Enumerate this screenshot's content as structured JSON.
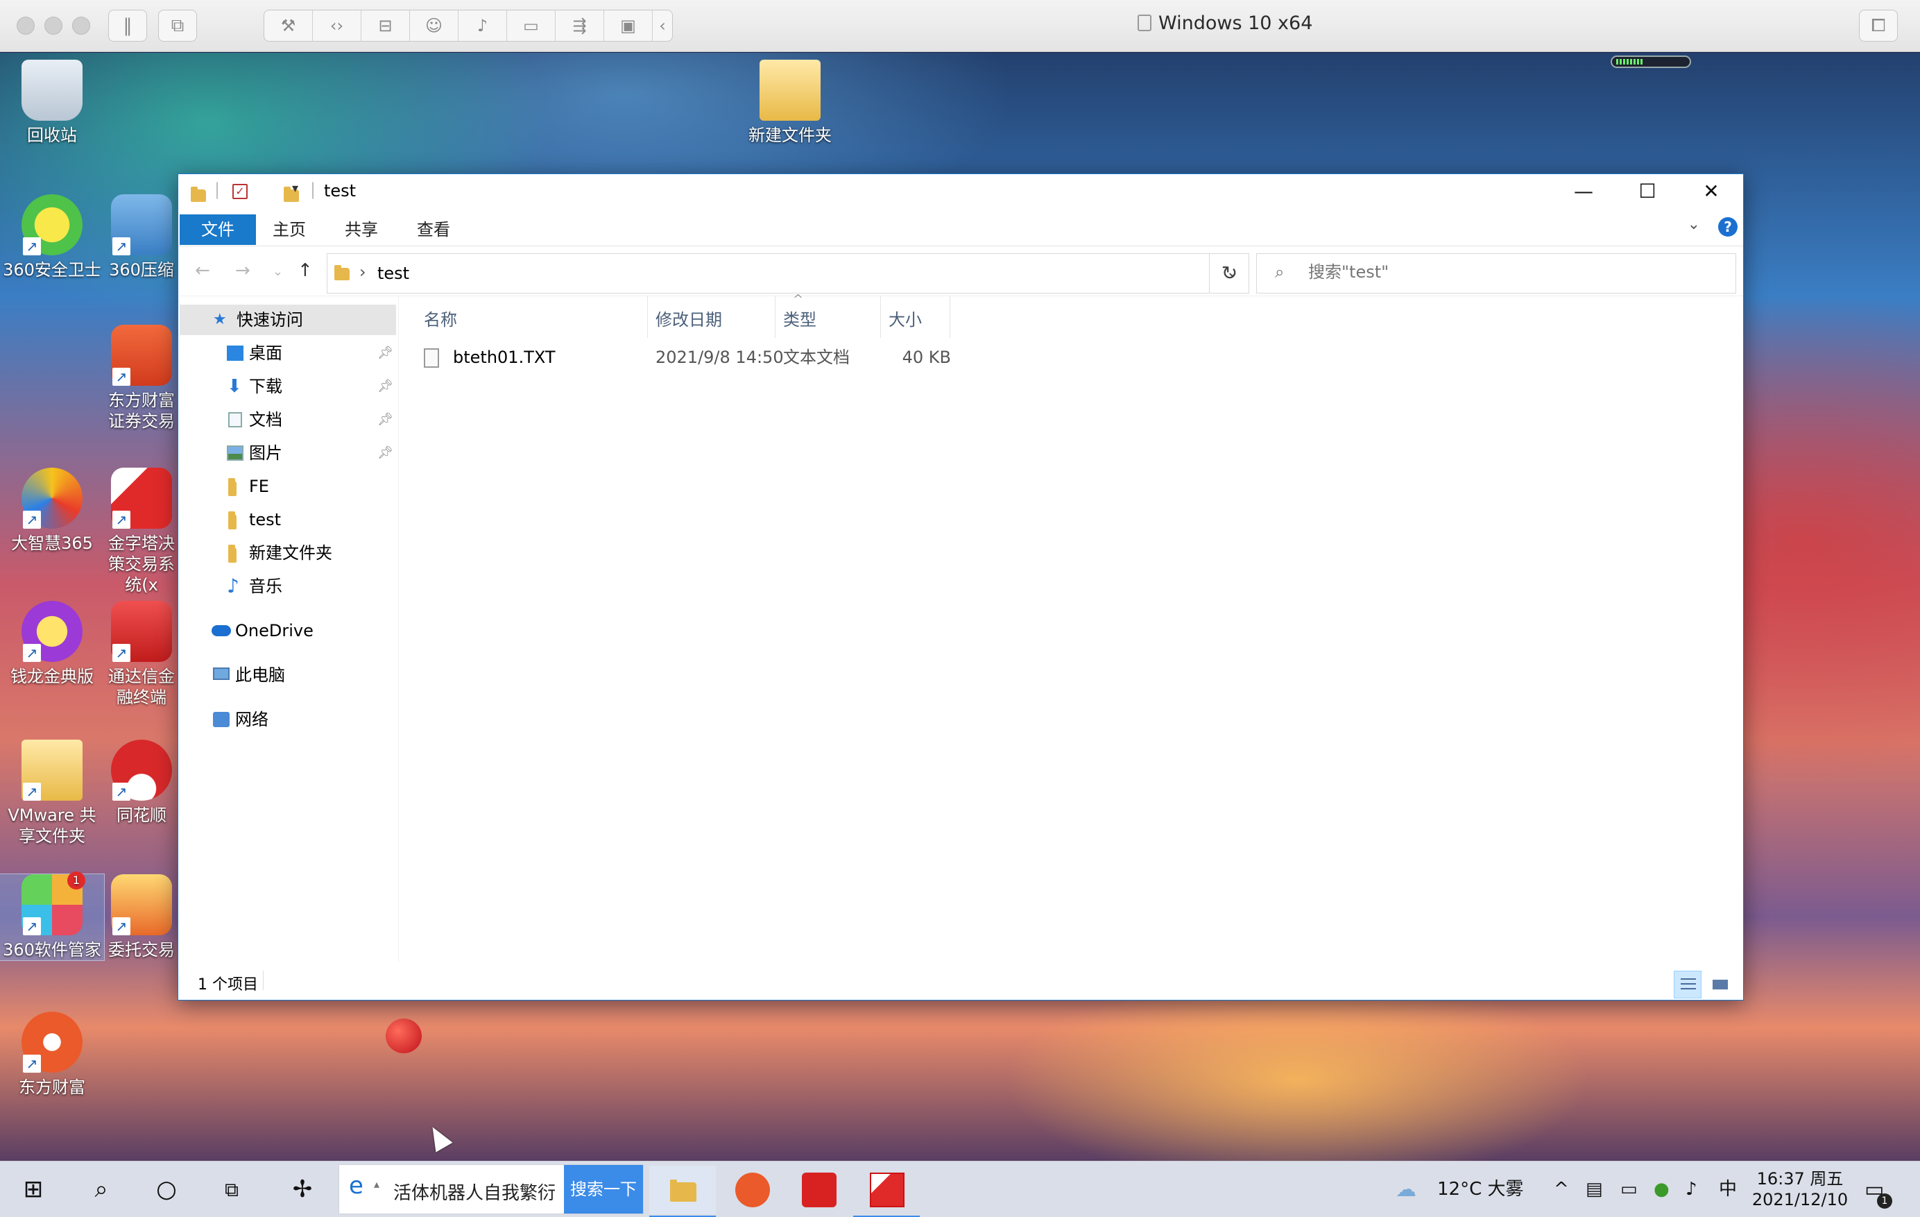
{
  "vm": {
    "title": "Windows 10 x64",
    "toolbar_icons": [
      "wrench-icon",
      "code-icon",
      "drive-icon",
      "user-icon",
      "volume-icon",
      "camera-icon",
      "usb-icon",
      "folder-share-icon",
      "chevron-left-icon"
    ]
  },
  "desktop": {
    "icons": [
      {
        "label": "回收站",
        "name": "recycle-bin"
      },
      {
        "label": "新建文件夹",
        "name": "new-folder"
      },
      {
        "label": "360安全卫士",
        "name": "360-security"
      },
      {
        "label": "360压缩",
        "name": "360-zip"
      },
      {
        "label": "东方财富证券交易",
        "name": "eastmoney-securities"
      },
      {
        "label": "大智慧365",
        "name": "dzh365"
      },
      {
        "label": "金字塔决策交易系统(x",
        "name": "pyramid-trading"
      },
      {
        "label": "钱龙金典版",
        "name": "qianlong"
      },
      {
        "label": "通达信金融终端",
        "name": "tdx-terminal"
      },
      {
        "label": "VMware 共享文件夹",
        "name": "vmware-shared"
      },
      {
        "label": "同花顺",
        "name": "tonghuashun"
      },
      {
        "label": "360软件管家",
        "name": "360-software-manager",
        "badge": "1"
      },
      {
        "label": "委托交易",
        "name": "entrust-trade"
      },
      {
        "label": "东方财富",
        "name": "eastmoney"
      }
    ]
  },
  "explorer": {
    "title": "test",
    "ribbon_tabs": [
      "文件",
      "主页",
      "共享",
      "查看"
    ],
    "address": {
      "path": "test"
    },
    "search": {
      "placeholder": "搜索\"test\""
    },
    "nav": {
      "quick_access": "快速访问",
      "items": [
        {
          "label": "桌面",
          "pinned": true
        },
        {
          "label": "下载",
          "pinned": true
        },
        {
          "label": "文档",
          "pinned": true
        },
        {
          "label": "图片",
          "pinned": true
        },
        {
          "label": "FE",
          "pinned": false
        },
        {
          "label": "test",
          "pinned": false
        },
        {
          "label": "新建文件夹",
          "pinned": false
        },
        {
          "label": "音乐",
          "pinned": false
        }
      ],
      "onedrive": "OneDrive",
      "this_pc": "此电脑",
      "network": "网络"
    },
    "columns": {
      "name": "名称",
      "modified": "修改日期",
      "type": "类型",
      "size": "大小"
    },
    "files": [
      {
        "name": "bteth01.TXT",
        "modified": "2021/9/8 14:50",
        "type": "文本文档",
        "size": "40 KB"
      }
    ],
    "status": "1 个项目"
  },
  "taskbar": {
    "search_text": "活体机器人自我繁衍",
    "search_button": "搜索一下",
    "weather": "12°C 大雾",
    "ime": "中",
    "time": "16:37 周五",
    "date": "2021/12/10",
    "notification_badge": "1"
  },
  "colors": {
    "accent": "#1979ca",
    "taskbar_accent": "#3b8be8"
  }
}
